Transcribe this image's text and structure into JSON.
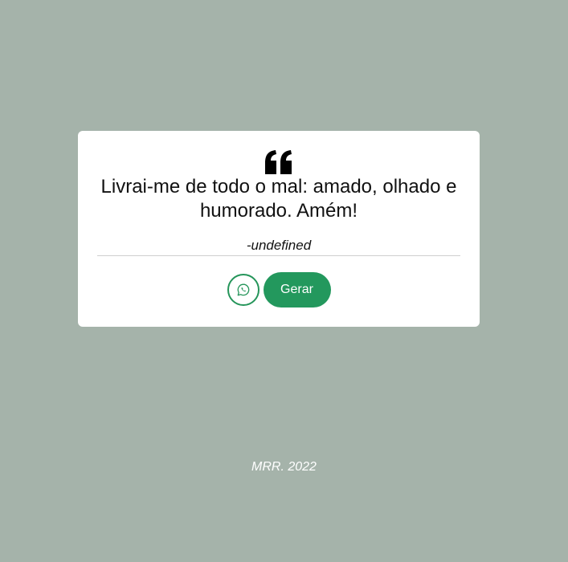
{
  "card": {
    "quote_icon": "left-quote-icon",
    "quote": "Livrai-me de todo o mal: amado, olhado e humorado. Amém!",
    "author": "-undefined",
    "share_icon": "whatsapp-icon",
    "generate_label": "Gerar"
  },
  "footer": {
    "text": "MRR. 2022"
  },
  "colors": {
    "background": "#a5b3aa",
    "accent": "#23985d",
    "card": "#ffffff"
  }
}
